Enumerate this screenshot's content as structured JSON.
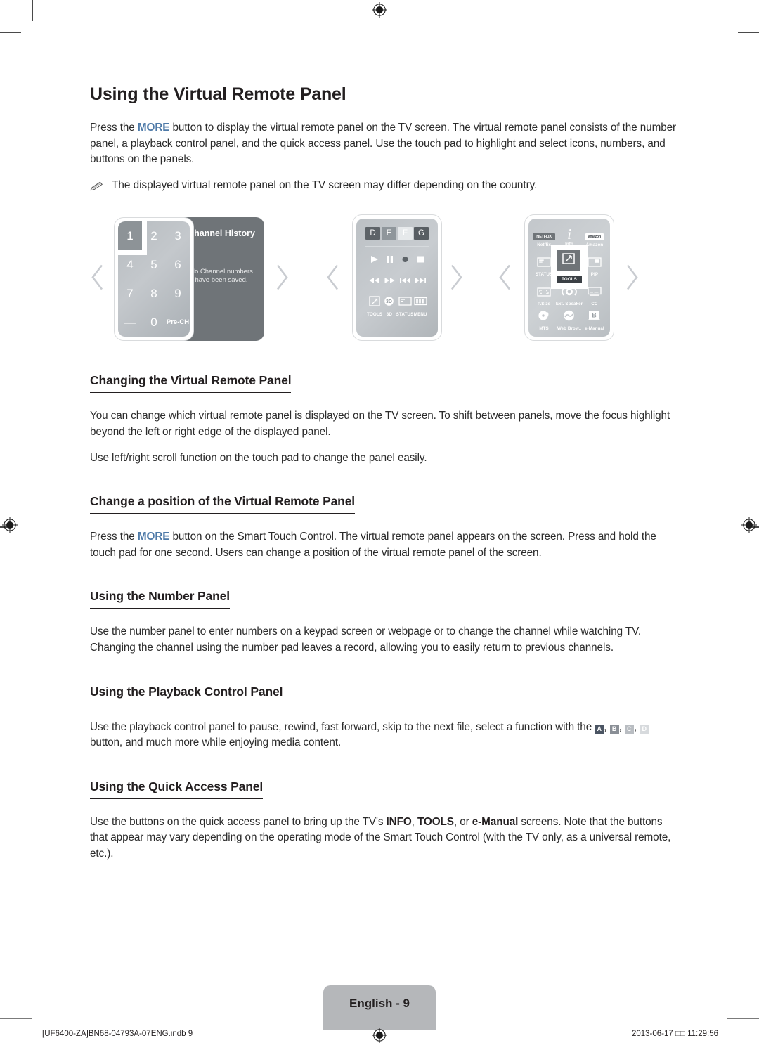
{
  "document": {
    "title": "Using the Virtual Remote Panel",
    "intro": "Press the MORE button to display the virtual remote panel on the TV screen. The virtual remote panel consists of the number panel, a playback control panel, and the quick access panel. Use the touch pad to highlight and select icons, numbers, and buttons on the panels.",
    "intro_more_keyword": "MORE",
    "note": "The displayed virtual remote panel on the TV screen may differ depending on the country.",
    "note_icon": "pencil-icon"
  },
  "illustration": {
    "number_panel": {
      "keys": [
        "1",
        "2",
        "3",
        "4",
        "5",
        "6",
        "7",
        "8",
        "9",
        "—",
        "0",
        "Pre-CH"
      ],
      "pre_ch_line1": "Pre-",
      "pre_ch_line2": "CH",
      "selected_key": "1",
      "channel_history": {
        "title": "Channel History",
        "message_line1": "No Channel numbers",
        "message_line2": "have been saved."
      }
    },
    "playback_panel": {
      "color_keys": [
        {
          "label": "D",
          "color": "#5d6368"
        },
        {
          "label": "E",
          "color": "#8f969b"
        },
        {
          "label": "F",
          "color": "#e6e9eb"
        },
        {
          "label": "G",
          "color": "#585e63"
        }
      ],
      "transport_row1": [
        "play-icon",
        "pause-icon",
        "record-icon",
        "stop-icon"
      ],
      "transport_row2": [
        "rewind-icon",
        "fast-forward-icon",
        "previous-icon",
        "next-icon"
      ],
      "function_row": [
        {
          "icon": "tools-icon",
          "label": "TOOLS"
        },
        {
          "icon": "3d-icon",
          "label": "3D"
        },
        {
          "icon": "status-icon",
          "label": "STATUS"
        },
        {
          "icon": "menu-icon",
          "label": "MENU"
        }
      ]
    },
    "quick_access_panel": {
      "items": [
        {
          "icon": "netflix-icon",
          "label": "Netflix",
          "badge": "NETFLIX"
        },
        {
          "icon": "info-icon",
          "label": "Info",
          "glyph": "i"
        },
        {
          "icon": "amazon-icon",
          "label": "Amazon",
          "badge": "amazon"
        },
        {
          "icon": "status-icon",
          "label": "STATUS"
        },
        {
          "icon": "tools-icon",
          "label": "TOOLS",
          "focused": true
        },
        {
          "icon": "pip-icon",
          "label": "PIP"
        },
        {
          "icon": "picture-size-icon",
          "label": "P.Size"
        },
        {
          "icon": "ext-speaker-icon",
          "label": "Ext. Speaker"
        },
        {
          "icon": "cc-icon",
          "label": "CC"
        },
        {
          "icon": "mts-icon",
          "label": "MTS"
        },
        {
          "icon": "web-browser-icon",
          "label": "Web Brow.."
        },
        {
          "icon": "e-manual-icon",
          "label": "e-Manual"
        }
      ]
    },
    "chevrons": [
      "chevron-left-icon",
      "chevron-right-icon"
    ]
  },
  "sections": [
    {
      "heading": "Changing the Virtual Remote Panel",
      "paragraphs": [
        "You can change which virtual remote panel is displayed on the TV screen. To shift between panels, move the focus highlight beyond the left or right edge of the displayed panel.",
        "Use left/right scroll function on the touch pad to change the panel easily."
      ]
    },
    {
      "heading": "Change a position of the Virtual Remote Panel",
      "paragraphs": [
        "Press the MORE button on the Smart Touch Control. The virtual remote panel appears on the screen. Press and hold the touch pad for one second. Users can change a position of the virtual remote panel of the screen."
      ]
    },
    {
      "heading": "Using the Number Panel",
      "paragraphs": [
        "Use the number panel to enter numbers on a keypad screen or webpage or to change the channel while watching TV. Changing the channel using the number pad leaves a record, allowing you to easily return to previous channels."
      ]
    },
    {
      "heading": "Using the Playback Control Panel",
      "paragraphs": [
        "Use the playback control panel to pause, rewind, fast forward, skip to the next file, select a function with the A, B, C, D button, and much more while enjoying media content."
      ],
      "inline_badges": [
        {
          "label": "A",
          "bg": "#4b5563",
          "fg": "#ffffff"
        },
        {
          "label": "B",
          "bg": "#8a8f96",
          "fg": "#ffffff"
        },
        {
          "label": "C",
          "bg": "#b9bdc2",
          "fg": "#ffffff"
        },
        {
          "label": "D",
          "bg": "#d7dadd",
          "fg": "#ffffff"
        }
      ]
    },
    {
      "heading": "Using the Quick Access Panel",
      "paragraphs": [
        "Use the buttons on the quick access panel to bring up the TV's INFO, TOOLS, or e-Manual screens. Note that the buttons that appear may vary depending on the operating mode of the Smart Touch Control (with the TV only, as a universal remote, etc.)."
      ],
      "bold_terms": [
        "INFO",
        "TOOLS",
        "e-Manual"
      ]
    }
  ],
  "footer": {
    "page_label": "English - 9",
    "file_name": "[UF6400-ZA]BN68-04793A-07ENG.indb   9",
    "timestamp": "2013-06-17   □□ 11:29:56",
    "registration_icon": "registration-target-icon"
  },
  "sec_text": {
    "s1_h": "Changing the Virtual Remote Panel",
    "s1_p1": "You can change which virtual remote panel is displayed on the TV screen. To shift between panels, move the focus highlight beyond the left or right edge of the displayed panel.",
    "s1_p2": "Use left/right scroll function on the touch pad to change the panel easily.",
    "s2_h": "Change a position of the Virtual Remote Panel",
    "s2_p1a": "Press the ",
    "s2_p1b": "MORE",
    "s2_p1c": " button on the Smart Touch Control. The virtual remote panel appears on the screen. Press and hold the touch pad for one second. Users can change a position of the virtual remote panel of the screen.",
    "s3_h": "Using the Number Panel",
    "s3_p1": "Use the number panel to enter numbers on a keypad screen or webpage or to change the channel while watching TV. Changing the channel using the number pad leaves a record, allowing you to easily return to previous channels.",
    "s4_h": "Using the Playback Control Panel",
    "s4_p1a": "Use the playback control panel to pause, rewind, fast forward, skip to the next file, select a function with the ",
    "s4_p1b": " button, and much more while enjoying media content.",
    "s5_h": "Using the Quick Access Panel",
    "s5_p1a": "Use the buttons on the quick access panel to bring up the TV's ",
    "s5_b1": "INFO",
    "s5_p1b": ", ",
    "s5_b2": "TOOLS",
    "s5_p1c": ", or ",
    "s5_b3": "e-Manual",
    "s5_p1d": " screens. Note that the buttons that appear may vary depending on the operating mode of the Smart Touch Control (with the TV only, as a universal remote, etc.).",
    "intro_a": "Press the ",
    "intro_b": "MORE",
    "intro_c": " button to display the virtual remote panel on the TV screen. The virtual remote panel consists of the number panel, a playback control panel, and the quick access panel. Use the touch pad to highlight and select icons, numbers, and buttons on the panels."
  }
}
